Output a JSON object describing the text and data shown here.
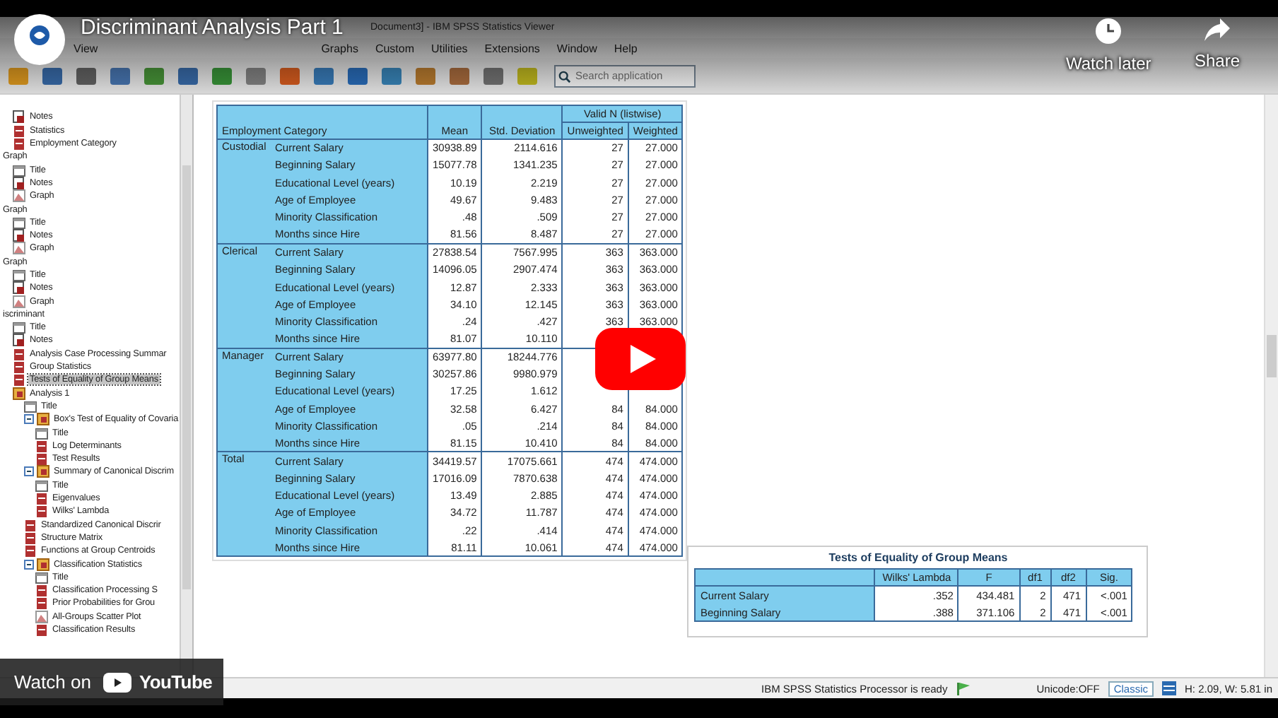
{
  "window": {
    "title": "Document3] - IBM SPSS Statistics Viewer"
  },
  "menu": [
    "View",
    "Graphs",
    "Custom",
    "Utilities",
    "Extensions",
    "Window",
    "Help"
  ],
  "search": {
    "placeholder": "Search application"
  },
  "tree": [
    {
      "children": [
        {
          "label": "Notes",
          "kind": "notes",
          "selected": false
        },
        {
          "label": "Statistics",
          "kind": "table",
          "selected": false
        },
        {
          "label": "Employment Category",
          "kind": "table",
          "selected": false
        }
      ]
    },
    {
      "label": "Graph",
      "selected": false,
      "children": [
        {
          "label": "Title",
          "kind": "title",
          "selected": false
        },
        {
          "label": "Notes",
          "kind": "notes",
          "selected": false
        },
        {
          "label": "Graph",
          "kind": "graph",
          "selected": false
        }
      ]
    },
    {
      "label": "Graph",
      "selected": false,
      "children": [
        {
          "label": "Title",
          "kind": "title",
          "selected": false
        },
        {
          "label": "Notes",
          "kind": "notes",
          "selected": false
        },
        {
          "label": "Graph",
          "kind": "graph",
          "selected": false
        }
      ]
    },
    {
      "label": "Graph",
      "selected": false,
      "children": [
        {
          "label": "Title",
          "kind": "title",
          "selected": false
        },
        {
          "label": "Notes",
          "kind": "notes",
          "selected": false
        },
        {
          "label": "Graph",
          "kind": "graph",
          "selected": false
        }
      ]
    },
    {
      "label": "iscriminant",
      "selected": false,
      "children": [
        {
          "label": "Title",
          "kind": "title",
          "selected": false
        },
        {
          "label": "Notes",
          "kind": "notes",
          "selected": false
        },
        {
          "label": "Analysis Case Processing Summar",
          "kind": "table",
          "selected": false
        },
        {
          "label": "Group Statistics",
          "kind": "table",
          "selected": false
        },
        {
          "label": "Tests of Equality of Group Means",
          "kind": "table",
          "selected": true
        },
        {
          "label": "Analysis 1",
          "kind": "book",
          "selected": false,
          "children": [
            {
              "label": "Title",
              "kind": "title",
              "selected": false
            },
            {
              "label": "Box's Test of Equality of Covaria",
              "kind": "book",
              "expanded": true,
              "selected": false,
              "children": [
                {
                  "label": "Title",
                  "kind": "title",
                  "selected": false
                },
                {
                  "label": "Log Determinants",
                  "kind": "table",
                  "selected": false
                },
                {
                  "label": "Test Results",
                  "kind": "table",
                  "selected": false
                }
              ]
            },
            {
              "label": "Summary of Canonical Discrim",
              "kind": "book",
              "expanded": true,
              "selected": false,
              "children": [
                {
                  "label": "Title",
                  "kind": "title",
                  "selected": false
                },
                {
                  "label": "Eigenvalues",
                  "kind": "table",
                  "selected": false
                },
                {
                  "label": "Wilks' Lambda",
                  "kind": "table",
                  "selected": false
                }
              ]
            },
            {
              "label": "Standardized Canonical Discrir",
              "kind": "table",
              "selected": false
            },
            {
              "label": "Structure Matrix",
              "kind": "table",
              "selected": false
            },
            {
              "label": "Functions at Group Centroids",
              "kind": "table",
              "selected": false
            },
            {
              "label": "Classification Statistics",
              "kind": "book",
              "expanded": true,
              "selected": false,
              "children": [
                {
                  "label": "Title",
                  "kind": "title",
                  "selected": false
                },
                {
                  "label": "Classification Processing S",
                  "kind": "table",
                  "selected": false
                },
                {
                  "label": "Prior Probabilities for Grou",
                  "kind": "table",
                  "selected": false
                },
                {
                  "label": "All-Groups Scatter Plot",
                  "kind": "graph",
                  "selected": false
                },
                {
                  "label": "Classification Results",
                  "kind": "table",
                  "selected": false
                }
              ]
            }
          ]
        }
      ]
    }
  ],
  "stats_table": {
    "corner": "Employment Category",
    "mean": "Mean",
    "std": "Std. Deviation",
    "valid": "Valid N (listwise)",
    "unweighted": "Unweighted",
    "weighted": "Weighted",
    "groups": [
      {
        "name": "Custodial",
        "rows": [
          {
            "label": "Current Salary",
            "values": [
              "30938.89",
              "2114.616",
              "27",
              "27.000"
            ]
          },
          {
            "label": "Beginning Salary",
            "values": [
              "15077.78",
              "1341.235",
              "27",
              "27.000"
            ]
          },
          {
            "label": "Educational Level (years)",
            "values": [
              "10.19",
              "2.219",
              "27",
              "27.000"
            ]
          },
          {
            "label": "Age of  Employee",
            "values": [
              "49.67",
              "9.483",
              "27",
              "27.000"
            ]
          },
          {
            "label": "Minority Classification",
            "values": [
              ".48",
              ".509",
              "27",
              "27.000"
            ]
          },
          {
            "label": "Months since Hire",
            "values": [
              "81.56",
              "8.487",
              "27",
              "27.000"
            ]
          }
        ]
      },
      {
        "name": "Clerical",
        "rows": [
          {
            "label": "Current Salary",
            "values": [
              "27838.54",
              "7567.995",
              "363",
              "363.000"
            ]
          },
          {
            "label": "Beginning Salary",
            "values": [
              "14096.05",
              "2907.474",
              "363",
              "363.000"
            ]
          },
          {
            "label": "Educational Level (years)",
            "values": [
              "12.87",
              "2.333",
              "363",
              "363.000"
            ]
          },
          {
            "label": "Age of  Employee",
            "values": [
              "34.10",
              "12.145",
              "363",
              "363.000"
            ]
          },
          {
            "label": "Minority Classification",
            "values": [
              ".24",
              ".427",
              "363",
              "363.000"
            ]
          },
          {
            "label": "Months since Hire",
            "values": [
              "81.07",
              "10.110"
            ]
          }
        ]
      },
      {
        "name": "Manager",
        "rows": [
          {
            "label": "Current Salary",
            "values": [
              "63977.80",
              "18244.776"
            ]
          },
          {
            "label": "Beginning Salary",
            "values": [
              "30257.86",
              "9980.979"
            ]
          },
          {
            "label": "Educational Level (years)",
            "values": [
              "17.25",
              "1.612"
            ]
          },
          {
            "label": "Age of  Employee",
            "values": [
              "32.58",
              "6.427",
              "84",
              "84.000"
            ]
          },
          {
            "label": "Minority Classification",
            "values": [
              ".05",
              ".214",
              "84",
              "84.000"
            ]
          },
          {
            "label": "Months since Hire",
            "values": [
              "81.15",
              "10.410",
              "84",
              "84.000"
            ]
          }
        ]
      },
      {
        "name": "Total",
        "rows": [
          {
            "label": "Current Salary",
            "values": [
              "34419.57",
              "17075.661",
              "474",
              "474.000"
            ]
          },
          {
            "label": "Beginning Salary",
            "values": [
              "17016.09",
              "7870.638",
              "474",
              "474.000"
            ]
          },
          {
            "label": "Educational Level (years)",
            "values": [
              "13.49",
              "2.885",
              "474",
              "474.000"
            ]
          },
          {
            "label": "Age of  Employee",
            "values": [
              "34.72",
              "11.787",
              "474",
              "474.000"
            ]
          },
          {
            "label": "Minority Classification",
            "values": [
              ".22",
              ".414",
              "474",
              "474.000"
            ]
          },
          {
            "label": "Months since Hire",
            "values": [
              "81.11",
              "10.061",
              "474",
              "474.000"
            ]
          }
        ]
      }
    ]
  },
  "equality_table": {
    "title": "Tests of Equality of Group Means",
    "columns": [
      "Wilks' Lambda",
      "F",
      "df1",
      "df2",
      "Sig."
    ],
    "rows": [
      {
        "label": "Current Salary",
        "values": [
          ".352",
          "434.481",
          "2",
          "471",
          "<.001"
        ]
      },
      {
        "label": "Beginning Salary",
        "values": [
          ".388",
          "371.106",
          "2",
          "471",
          "<.001"
        ]
      }
    ]
  },
  "status_bar": {
    "message": "IBM SPSS Statistics Processor is ready",
    "unicode": "Unicode:OFF",
    "mode": "Classic",
    "size": "H: 2.09, W: 5.81 in"
  },
  "video_overlay": {
    "title": "Discriminant Analysis Part 1",
    "watch_later": "Watch later",
    "share": "Share",
    "watch_on": "Watch on",
    "brand": "YouTube"
  }
}
